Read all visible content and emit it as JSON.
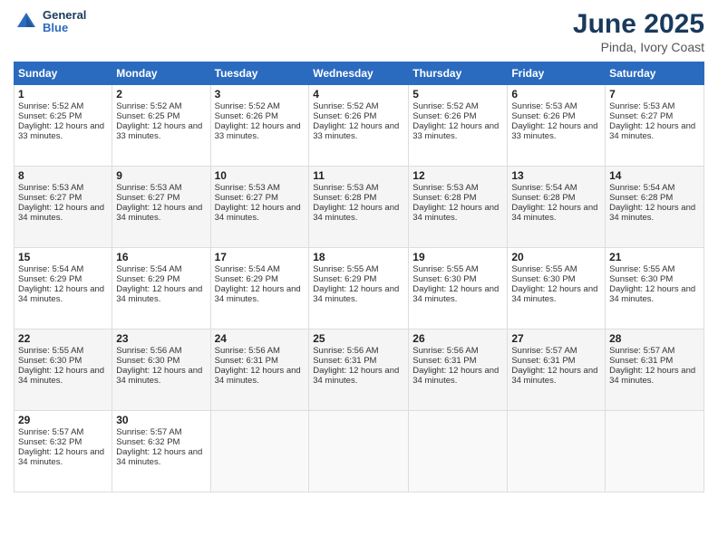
{
  "header": {
    "logo_line1": "General",
    "logo_line2": "Blue",
    "title": "June 2025",
    "subtitle": "Pinda, Ivory Coast"
  },
  "weekdays": [
    "Sunday",
    "Monday",
    "Tuesday",
    "Wednesday",
    "Thursday",
    "Friday",
    "Saturday"
  ],
  "weeks": [
    [
      {
        "day": "1",
        "sunrise": "5:52 AM",
        "sunset": "6:25 PM",
        "daylight": "12 hours and 33 minutes."
      },
      {
        "day": "2",
        "sunrise": "5:52 AM",
        "sunset": "6:25 PM",
        "daylight": "12 hours and 33 minutes."
      },
      {
        "day": "3",
        "sunrise": "5:52 AM",
        "sunset": "6:26 PM",
        "daylight": "12 hours and 33 minutes."
      },
      {
        "day": "4",
        "sunrise": "5:52 AM",
        "sunset": "6:26 PM",
        "daylight": "12 hours and 33 minutes."
      },
      {
        "day": "5",
        "sunrise": "5:52 AM",
        "sunset": "6:26 PM",
        "daylight": "12 hours and 33 minutes."
      },
      {
        "day": "6",
        "sunrise": "5:53 AM",
        "sunset": "6:26 PM",
        "daylight": "12 hours and 33 minutes."
      },
      {
        "day": "7",
        "sunrise": "5:53 AM",
        "sunset": "6:27 PM",
        "daylight": "12 hours and 34 minutes."
      }
    ],
    [
      {
        "day": "8",
        "sunrise": "5:53 AM",
        "sunset": "6:27 PM",
        "daylight": "12 hours and 34 minutes."
      },
      {
        "day": "9",
        "sunrise": "5:53 AM",
        "sunset": "6:27 PM",
        "daylight": "12 hours and 34 minutes."
      },
      {
        "day": "10",
        "sunrise": "5:53 AM",
        "sunset": "6:27 PM",
        "daylight": "12 hours and 34 minutes."
      },
      {
        "day": "11",
        "sunrise": "5:53 AM",
        "sunset": "6:28 PM",
        "daylight": "12 hours and 34 minutes."
      },
      {
        "day": "12",
        "sunrise": "5:53 AM",
        "sunset": "6:28 PM",
        "daylight": "12 hours and 34 minutes."
      },
      {
        "day": "13",
        "sunrise": "5:54 AM",
        "sunset": "6:28 PM",
        "daylight": "12 hours and 34 minutes."
      },
      {
        "day": "14",
        "sunrise": "5:54 AM",
        "sunset": "6:28 PM",
        "daylight": "12 hours and 34 minutes."
      }
    ],
    [
      {
        "day": "15",
        "sunrise": "5:54 AM",
        "sunset": "6:29 PM",
        "daylight": "12 hours and 34 minutes."
      },
      {
        "day": "16",
        "sunrise": "5:54 AM",
        "sunset": "6:29 PM",
        "daylight": "12 hours and 34 minutes."
      },
      {
        "day": "17",
        "sunrise": "5:54 AM",
        "sunset": "6:29 PM",
        "daylight": "12 hours and 34 minutes."
      },
      {
        "day": "18",
        "sunrise": "5:55 AM",
        "sunset": "6:29 PM",
        "daylight": "12 hours and 34 minutes."
      },
      {
        "day": "19",
        "sunrise": "5:55 AM",
        "sunset": "6:30 PM",
        "daylight": "12 hours and 34 minutes."
      },
      {
        "day": "20",
        "sunrise": "5:55 AM",
        "sunset": "6:30 PM",
        "daylight": "12 hours and 34 minutes."
      },
      {
        "day": "21",
        "sunrise": "5:55 AM",
        "sunset": "6:30 PM",
        "daylight": "12 hours and 34 minutes."
      }
    ],
    [
      {
        "day": "22",
        "sunrise": "5:55 AM",
        "sunset": "6:30 PM",
        "daylight": "12 hours and 34 minutes."
      },
      {
        "day": "23",
        "sunrise": "5:56 AM",
        "sunset": "6:30 PM",
        "daylight": "12 hours and 34 minutes."
      },
      {
        "day": "24",
        "sunrise": "5:56 AM",
        "sunset": "6:31 PM",
        "daylight": "12 hours and 34 minutes."
      },
      {
        "day": "25",
        "sunrise": "5:56 AM",
        "sunset": "6:31 PM",
        "daylight": "12 hours and 34 minutes."
      },
      {
        "day": "26",
        "sunrise": "5:56 AM",
        "sunset": "6:31 PM",
        "daylight": "12 hours and 34 minutes."
      },
      {
        "day": "27",
        "sunrise": "5:57 AM",
        "sunset": "6:31 PM",
        "daylight": "12 hours and 34 minutes."
      },
      {
        "day": "28",
        "sunrise": "5:57 AM",
        "sunset": "6:31 PM",
        "daylight": "12 hours and 34 minutes."
      }
    ],
    [
      {
        "day": "29",
        "sunrise": "5:57 AM",
        "sunset": "6:32 PM",
        "daylight": "12 hours and 34 minutes."
      },
      {
        "day": "30",
        "sunrise": "5:57 AM",
        "sunset": "6:32 PM",
        "daylight": "12 hours and 34 minutes."
      },
      null,
      null,
      null,
      null,
      null
    ]
  ]
}
